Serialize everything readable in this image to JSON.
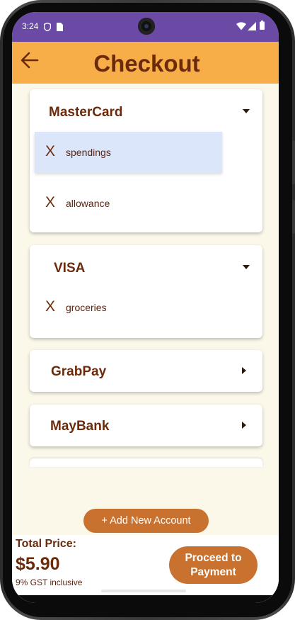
{
  "status_bar": {
    "time": "3:24",
    "left_icons": [
      "shield-icon",
      "sim-card-icon"
    ],
    "right_icons": [
      "wifi-icon",
      "signal-icon",
      "battery-icon"
    ],
    "color": "#6a4aa4"
  },
  "header": {
    "title": "Checkout",
    "back_icon": "arrow-left-icon",
    "color": "#f7ad48"
  },
  "payment_methods": [
    {
      "name": "MasterCard",
      "expanded": true,
      "accounts": [
        {
          "label": "spendings",
          "remove_label": "X",
          "selected": true
        },
        {
          "label": "allowance",
          "remove_label": "X",
          "selected": false
        }
      ]
    },
    {
      "name": "VISA",
      "expanded": true,
      "accounts": [
        {
          "label": "groceries",
          "remove_label": "X",
          "selected": false
        }
      ]
    },
    {
      "name": "GrabPay",
      "expanded": false,
      "accounts": []
    },
    {
      "name": "MayBank",
      "expanded": false,
      "accounts": []
    }
  ],
  "add_account_label": "+ Add New Account",
  "footer": {
    "total_label": "Total Price:",
    "total_price": "$5.90",
    "gst_note": "9% GST inclusive",
    "proceed_label": "Proceed to Payment"
  },
  "colors": {
    "accent_brown": "#6b2b0a",
    "button_orange": "#c9712f",
    "background_cream": "#fbf8e9",
    "selection_blue": "#dce6fa"
  }
}
